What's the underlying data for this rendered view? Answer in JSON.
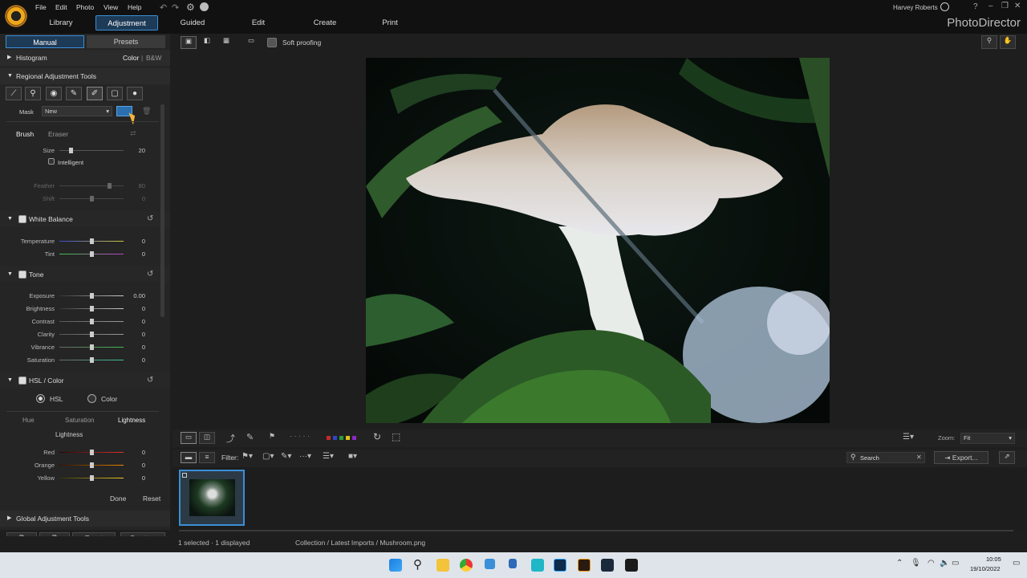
{
  "menu": [
    "File",
    "Edit",
    "Photo",
    "View",
    "Help"
  ],
  "main_tabs": [
    "Library",
    "Adjustment",
    "Guided",
    "Edit",
    "Create",
    "Print"
  ],
  "user": "Harvey Roberts",
  "brand": "PhotoDirector",
  "left": {
    "subtabs": [
      "Manual",
      "Presets"
    ],
    "histogram": "Histogram",
    "color": "Color",
    "bw": "B&W",
    "regional": "Regional Adjustment Tools",
    "mask_label": "Mask",
    "mask_value": "New",
    "brush": "Brush",
    "eraser": "Eraser",
    "size_label": "Size",
    "size_val": "20",
    "intelligent": "Intelligent",
    "feather_label": "Feather",
    "feather_val": "80",
    "shift_label": "Shift",
    "shift_val": "0",
    "wb": "White Balance",
    "temp": "Temperature",
    "temp_val": "0",
    "tint": "Tint",
    "tint_val": "0",
    "tone": "Tone",
    "tone_rows": [
      {
        "l": "Exposure",
        "v": "0.00"
      },
      {
        "l": "Brightness",
        "v": "0"
      },
      {
        "l": "Contrast",
        "v": "0"
      },
      {
        "l": "Clarity",
        "v": "0"
      },
      {
        "l": "Vibrance",
        "v": "0"
      },
      {
        "l": "Saturation",
        "v": "0"
      }
    ],
    "hsl": "HSL / Color",
    "hsl_radio": "HSL",
    "color_radio": "Color",
    "hsl_tabs": [
      "Hue",
      "Saturation",
      "Lightness"
    ],
    "lightness_title": "Lightness",
    "hsl_rows": [
      {
        "l": "Red",
        "v": "0"
      },
      {
        "l": "Orange",
        "v": "0"
      },
      {
        "l": "Yellow",
        "v": "0"
      }
    ],
    "done": "Done",
    "reset": "Reset",
    "global": "Global Adjustment Tools",
    "reset_btn": "Reset",
    "create_btn": "Create..."
  },
  "soft_proofing": "Soft proofing",
  "zoom_label": "Zoom:",
  "zoom_value": "Fit",
  "filter_label": "Filter:",
  "search_placeholder": "Search",
  "export": "Export...",
  "status_left": "1 selected · 1 displayed",
  "status_path": "Collection / Latest Imports / Mushroom.png",
  "clock_time": "10:05",
  "clock_date": "19/10/2022"
}
